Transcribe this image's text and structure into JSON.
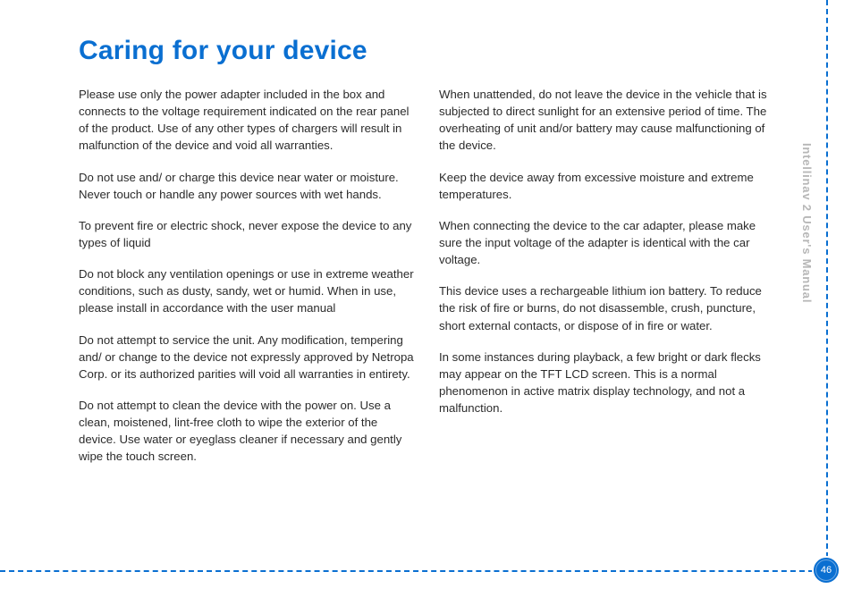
{
  "title": "Caring for your device",
  "side_label": "Intellinav 2 User's Manual",
  "page_number": "46",
  "left_column": [
    "Please use only the power adapter included in the box and connects to the voltage requirement indicated on the rear panel of the product. Use of any other types of chargers will result in malfunction of the device and void all warranties.",
    "Do not use and/ or charge this device near water or moisture. Never touch or handle any power sources with wet hands.",
    "To prevent fire or electric shock, never expose the device to any types of liquid",
    "Do not block any ventilation openings or use in extreme weather conditions, such as dusty, sandy, wet or humid.  When in use, please install in accordance with the user manual",
    "Do not attempt to service the unit. Any modification, tempering and/ or change to the device not expressly approved by Netropa Corp. or its authorized parities will void all warranties in entirety.",
    "Do not attempt to clean the device with the power on. Use a clean, moistened, lint-free cloth to wipe the exterior of the device. Use water or eyeglass cleaner if necessary and gently wipe the touch screen."
  ],
  "right_column": [
    "When unattended, do not leave the device in the vehicle that is subjected to direct sunlight for an extensive period of time. The overheating of unit and/or battery may cause malfunctioning of the device.",
    "Keep the device away from excessive moisture and extreme temperatures.",
    "When connecting the device to the car adapter, please make sure the input voltage of the adapter is identical with the car voltage.",
    "This device uses a rechargeable lithium ion battery. To reduce the risk of fire or burns, do not disassemble, crush, puncture, short external contacts, or dispose of in fire or water.",
    "In some instances during playback, a few bright or dark flecks may appear on the TFT LCD screen. This is a normal phenomenon in active matrix display technology, and not a malfunction."
  ]
}
